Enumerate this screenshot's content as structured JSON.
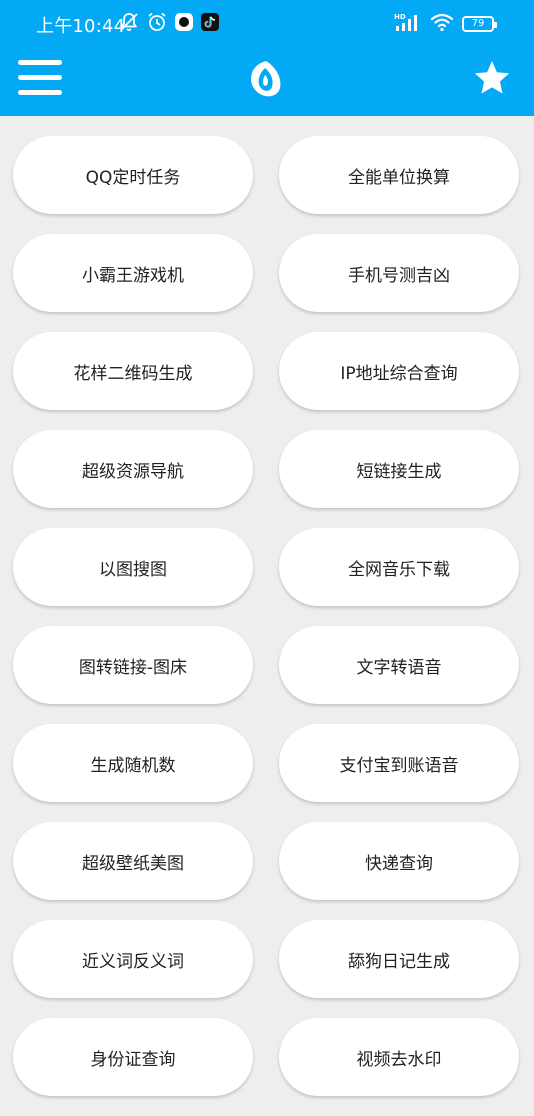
{
  "colors": {
    "header_bg": "#03a9f4",
    "page_bg": "#eeeeee",
    "button_bg": "#ffffff",
    "button_text": "#222222"
  },
  "status_bar": {
    "time": "上午10:44",
    "battery": "79",
    "network_badge": "HD",
    "icons_left": [
      "mute-icon",
      "alarm-icon",
      "app-notification-icon",
      "tiktok-icon"
    ],
    "icons_right": [
      "signal-icon",
      "wifi-icon",
      "battery-icon"
    ]
  },
  "toolbar": {
    "menu_icon": "hamburger-menu-icon",
    "logo_icon": "app-logo-icon",
    "favorite_icon": "star-icon"
  },
  "tools": [
    {
      "label": "QQ定时任务"
    },
    {
      "label": "全能单位换算"
    },
    {
      "label": "小霸王游戏机"
    },
    {
      "label": "手机号测吉凶"
    },
    {
      "label": "花样二维码生成"
    },
    {
      "label": "IP地址综合查询"
    },
    {
      "label": "超级资源导航"
    },
    {
      "label": "短链接生成"
    },
    {
      "label": "以图搜图"
    },
    {
      "label": "全网音乐下载"
    },
    {
      "label": "图转链接-图床"
    },
    {
      "label": "文字转语音"
    },
    {
      "label": "生成随机数"
    },
    {
      "label": "支付宝到账语音"
    },
    {
      "label": "超级壁纸美图"
    },
    {
      "label": "快递查询"
    },
    {
      "label": "近义词反义词"
    },
    {
      "label": "舔狗日记生成"
    },
    {
      "label": "身份证查询"
    },
    {
      "label": "视频去水印"
    }
  ]
}
